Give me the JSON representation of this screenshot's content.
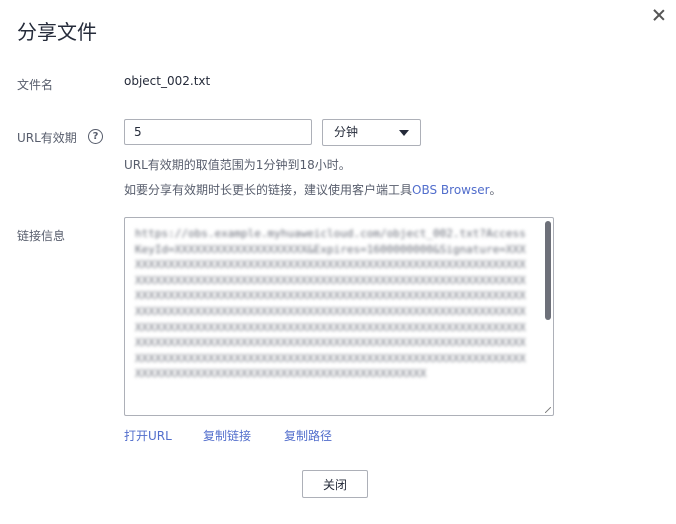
{
  "dialog": {
    "title": "分享文件",
    "close_icon": "close-icon"
  },
  "file": {
    "label": "文件名",
    "name": "object_002.txt"
  },
  "validity": {
    "label": "URL有效期",
    "help_icon": "question-circle-icon",
    "help_glyph": "?",
    "value": "5",
    "unit": "分钟",
    "hint_range": "URL有效期的取值范围为1分钟到18小时。",
    "hint_long_prefix": "如要分享有效期时长更长的链接，建议使用客户端工具",
    "hint_long_link": "OBS Browser",
    "hint_long_suffix": "。"
  },
  "link_info": {
    "label": "链接信息",
    "content": "https://obs.example.myhuaweicloud.com/object_002.txt?AccessKeyId=XXXXXXXXXXXXXXXXXXXX&Expires=1600000000&Signature=XXXXXXXXXXXXXXXXXXXXXXXXXXXXXXXXXXXXXXXXXXXXXXXXXXXXXXXXXXXXXXXXXXXXXXXXXXXXXXXXXXXXXXXXXXXXXXXXXXXXXXXXXXXXXXXXXXXXXXXXXXXXXXXXXXXXXXXXXXXXXXXXXXXXXXXXXXXXXXXXXXXXXXXXXXXXXXXXXXXXXXXXXXXXXXXXXXXXXXXXXXXXXXXXXXXXXXXXXXXXXXXXXXXXXXXXXXXXXXXXXXXXXXXXXXXXXXXXXXXXXXXXXXXXXXXXXXXXXXXXXXXXXXXXXXXXXXXXXXXXXXXXXXXXXXXXXXXXXXXXXXXXXXXXXXXXXXXXXXXXXXXXXXXXXXXXXXXXXXXXXXXXXXXXXXXXXXXXXXXXXXXXXXXXXXXXXXXXXXXXXXXXXXXXXXXXXXXXXXXXXXXXXXXXXXXXXXXXXXXXXXXXXXXXXXXXXXXXXXXX"
  },
  "actions": {
    "open_url": "打开URL",
    "copy_link": "复制链接",
    "copy_path": "复制路径"
  },
  "footer": {
    "close_label": "关闭"
  }
}
